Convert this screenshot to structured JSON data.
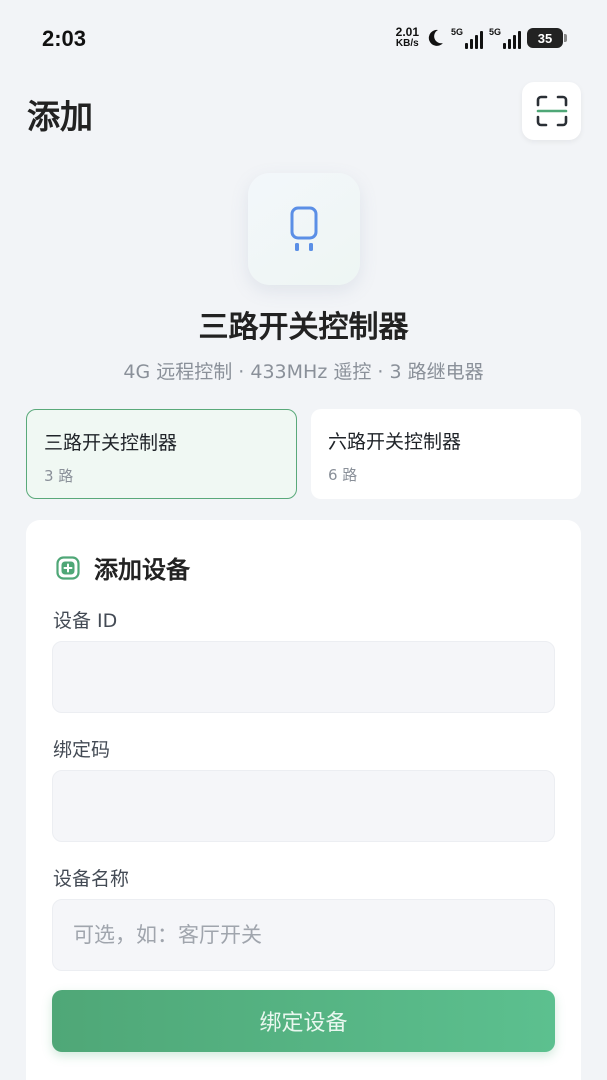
{
  "status_bar": {
    "time": "2:03",
    "net_speed_value": "2.01",
    "net_speed_unit": "KB/s",
    "sim1_label": "5G",
    "sim2_label": "5G",
    "battery": "35"
  },
  "header": {
    "title": "添加"
  },
  "device": {
    "name": "三路开关控制器",
    "description": "4G 远程控制 · 433MHz 遥控 · 3 路继电器"
  },
  "models": [
    {
      "name": "三路开关控制器",
      "sub": "3 路",
      "selected": true
    },
    {
      "name": "六路开关控制器",
      "sub": "6 路",
      "selected": false
    }
  ],
  "form": {
    "title": "添加设备",
    "device_id_label": "设备 ID",
    "device_id_value": "",
    "bind_code_label": "绑定码",
    "bind_code_value": "",
    "device_name_label": "设备名称",
    "device_name_placeholder": "可选，如：客厅开关",
    "submit_label": "绑定设备"
  },
  "colors": {
    "accent": "#4fa777",
    "icon_blue": "#5b8fe6"
  }
}
